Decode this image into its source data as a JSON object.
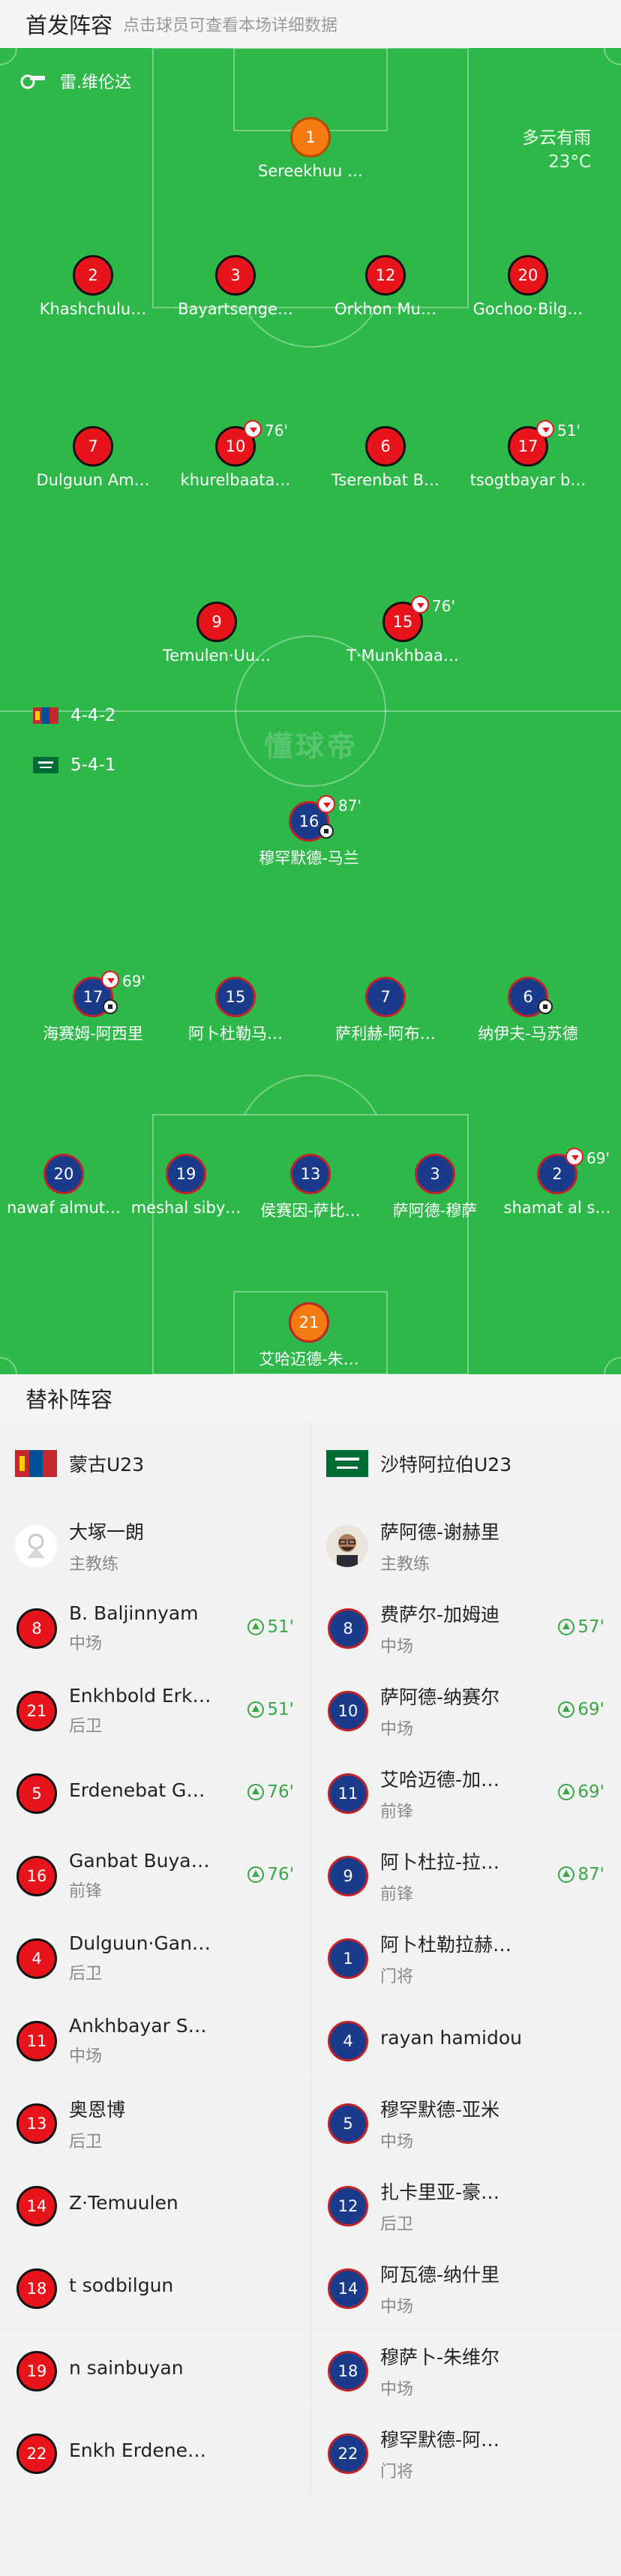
{
  "header": {
    "title": "首发阵容",
    "hint": "点击球员可查看本场详细数据"
  },
  "match": {
    "referee": "雷.维伦达",
    "weather": "多云有雨",
    "temperature": "23°C",
    "watermark": "懂球帝"
  },
  "home": {
    "name": "蒙古U23",
    "formation": "4-4-2",
    "coach": "大塚一朗",
    "coach_role": "主教练",
    "starters": [
      {
        "number": "1",
        "name": "Sereekhuu …",
        "gk": true
      },
      {
        "number": "2",
        "name": "Khashchulu…"
      },
      {
        "number": "3",
        "name": "Bayartsenge…"
      },
      {
        "number": "12",
        "name": "Orkhon Mu…"
      },
      {
        "number": "20",
        "name": "Gochoo·Bilg…"
      },
      {
        "number": "7",
        "name": "Dulguun Am…"
      },
      {
        "number": "10",
        "name": "khurelbaata…",
        "sub_out": "76'"
      },
      {
        "number": "6",
        "name": "Tserenbat B…"
      },
      {
        "number": "17",
        "name": "tsogtbayar b…",
        "sub_out": "51'"
      },
      {
        "number": "9",
        "name": "Temulen·Uu…"
      },
      {
        "number": "15",
        "name": "T·Munkhbaa…",
        "sub_out": "76'"
      }
    ],
    "subs": [
      {
        "number": "8",
        "name": "B. Baljinnyam",
        "pos": "中场",
        "in": "51'"
      },
      {
        "number": "21",
        "name": "Enkhbold Erk…",
        "pos": "后卫",
        "in": "51'"
      },
      {
        "number": "5",
        "name": "Erdenebat G…",
        "pos": "",
        "in": "76'"
      },
      {
        "number": "16",
        "name": "Ganbat Buya…",
        "pos": "前锋",
        "in": "76'"
      },
      {
        "number": "4",
        "name": "Dulguun·Gan…",
        "pos": "后卫"
      },
      {
        "number": "11",
        "name": "Ankhbayar S…",
        "pos": "中场"
      },
      {
        "number": "13",
        "name": "奥恩博",
        "pos": "后卫"
      },
      {
        "number": "14",
        "name": "Z·Temuulen",
        "pos": ""
      },
      {
        "number": "18",
        "name": "t sodbilgun",
        "pos": ""
      },
      {
        "number": "19",
        "name": "n sainbuyan",
        "pos": ""
      },
      {
        "number": "22",
        "name": "Enkh Erdene…",
        "pos": ""
      }
    ]
  },
  "away": {
    "name": "沙特阿拉伯U23",
    "formation": "5-4-1",
    "coach": "萨阿德-谢赫里",
    "coach_role": "主教练",
    "starters": [
      {
        "number": "16",
        "name": "穆罕默德-马兰",
        "sub_out": "87'",
        "goal": true
      },
      {
        "number": "17",
        "name": "海赛姆-阿西里",
        "sub_out": "69'",
        "goal": true
      },
      {
        "number": "15",
        "name": "阿卜杜勒马…"
      },
      {
        "number": "7",
        "name": "萨利赫-阿布…"
      },
      {
        "number": "6",
        "name": "纳伊夫-马苏德",
        "goal": true
      },
      {
        "number": "20",
        "name": "nawaf almut…"
      },
      {
        "number": "19",
        "name": "meshal siby…"
      },
      {
        "number": "13",
        "name": "侯赛因-萨比…"
      },
      {
        "number": "3",
        "name": "萨阿德-穆萨"
      },
      {
        "number": "2",
        "name": "shamat al s…",
        "sub_out": "69'"
      },
      {
        "number": "21",
        "name": "艾哈迈德-朱…",
        "gk": true
      }
    ],
    "subs": [
      {
        "number": "8",
        "name": "费萨尔-加姆迪",
        "pos": "中场",
        "in": "57'"
      },
      {
        "number": "10",
        "name": "萨阿德-纳赛尔",
        "pos": "中场",
        "in": "69'"
      },
      {
        "number": "11",
        "name": "艾哈迈德-加…",
        "pos": "前锋",
        "in": "69'"
      },
      {
        "number": "9",
        "name": "阿卜杜拉-拉…",
        "pos": "前锋",
        "in": "87'"
      },
      {
        "number": "1",
        "name": "阿卜杜勒拉赫…",
        "pos": "门将",
        "gk": true
      },
      {
        "number": "4",
        "name": "rayan hamidou",
        "pos": ""
      },
      {
        "number": "5",
        "name": "穆罕默德-亚米",
        "pos": "中场"
      },
      {
        "number": "12",
        "name": "扎卡里亚-豪…",
        "pos": "后卫"
      },
      {
        "number": "14",
        "name": "阿瓦德-纳什里",
        "pos": "中场"
      },
      {
        "number": "18",
        "name": "穆萨卜-朱维尔",
        "pos": "中场"
      },
      {
        "number": "22",
        "name": "穆罕默德-阿…",
        "pos": "门将"
      }
    ]
  },
  "subs_header": {
    "title": "替补阵容"
  },
  "colors": {
    "pitch": "#2eb84a",
    "home_shirt": "#e8141c",
    "away_shirt": "#1a3a8c",
    "keeper_shirt": "#f47a12",
    "sub_in": "#37a846"
  }
}
